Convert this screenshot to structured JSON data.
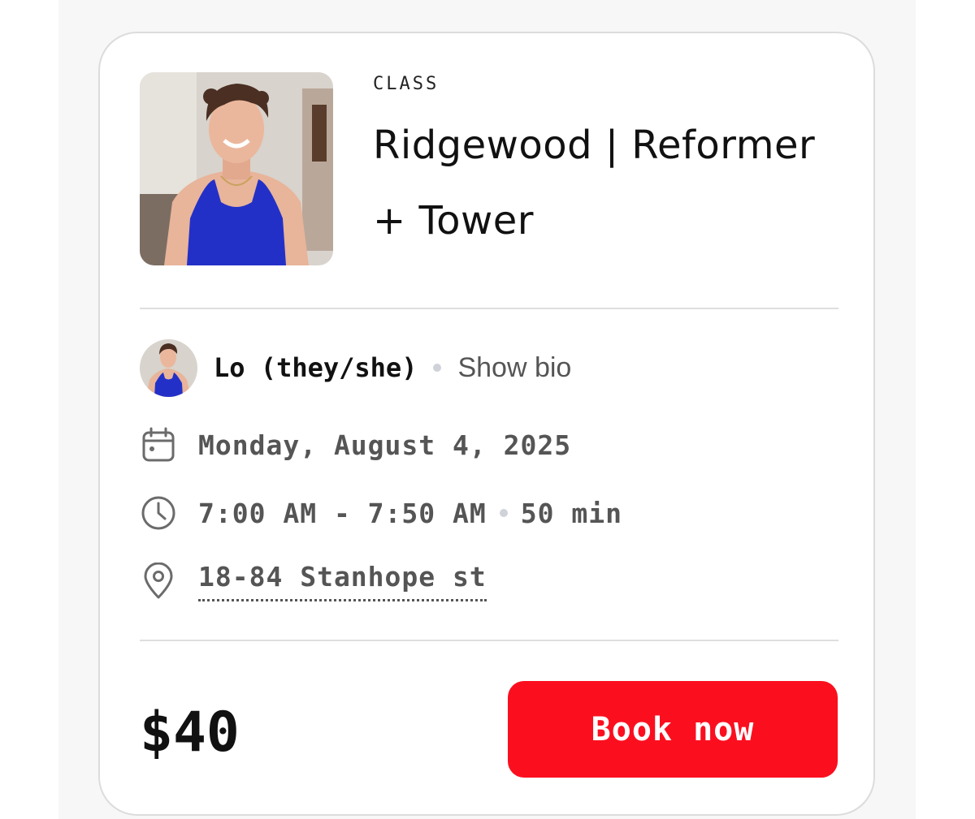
{
  "class": {
    "kicker": "CLASS",
    "title": "Ridgewood | Reformer + Tower",
    "photo_icon": "instructor-photo"
  },
  "instructor": {
    "name": "Lo (they/she)",
    "bio_link": "Show bio",
    "avatar_icon": "avatar"
  },
  "schedule": {
    "date": "Monday, August 4, 2025",
    "time": "7:00 AM - 7:50 AM",
    "duration": "50 min",
    "date_icon": "calendar-icon",
    "time_icon": "clock-icon"
  },
  "location": {
    "address": "18-84 Stanhope st",
    "icon": "location-pin-icon"
  },
  "booking": {
    "price": "$40",
    "button_label": "Book now"
  },
  "colors": {
    "accent": "#fb0f1f",
    "text": "#111111",
    "muted": "#555555",
    "divider": "#dedede",
    "bullet": "#cfd2d8"
  }
}
